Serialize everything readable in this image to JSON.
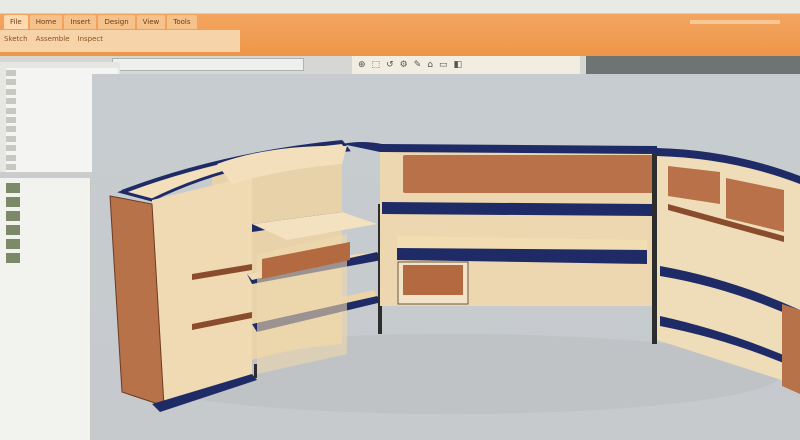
{
  "title_bar": {
    "items": [
      "",
      "",
      "",
      "",
      "",
      ""
    ]
  },
  "ribbon": {
    "tabs": [
      "File",
      "Home",
      "Insert",
      "Design",
      "View",
      "Tools"
    ],
    "row2": [
      "Sketch",
      "Assemble",
      "Inspect"
    ]
  },
  "toolbar": {
    "file_field_value": "",
    "tools": [
      "⊕",
      "⬚",
      "↺",
      "⚙",
      "✎",
      "⌂",
      "▭",
      "◧"
    ],
    "right_panel_labels": [
      "",
      "",
      ""
    ]
  },
  "browser_rows": 11,
  "library_items": 6,
  "colors": {
    "ribbon": "#ee9648",
    "panel_wood": "#f1dcb6",
    "end_panel": "#b7724a",
    "edge_navy": "#1f2b66",
    "viewport_bg": "#c7ccd0"
  }
}
